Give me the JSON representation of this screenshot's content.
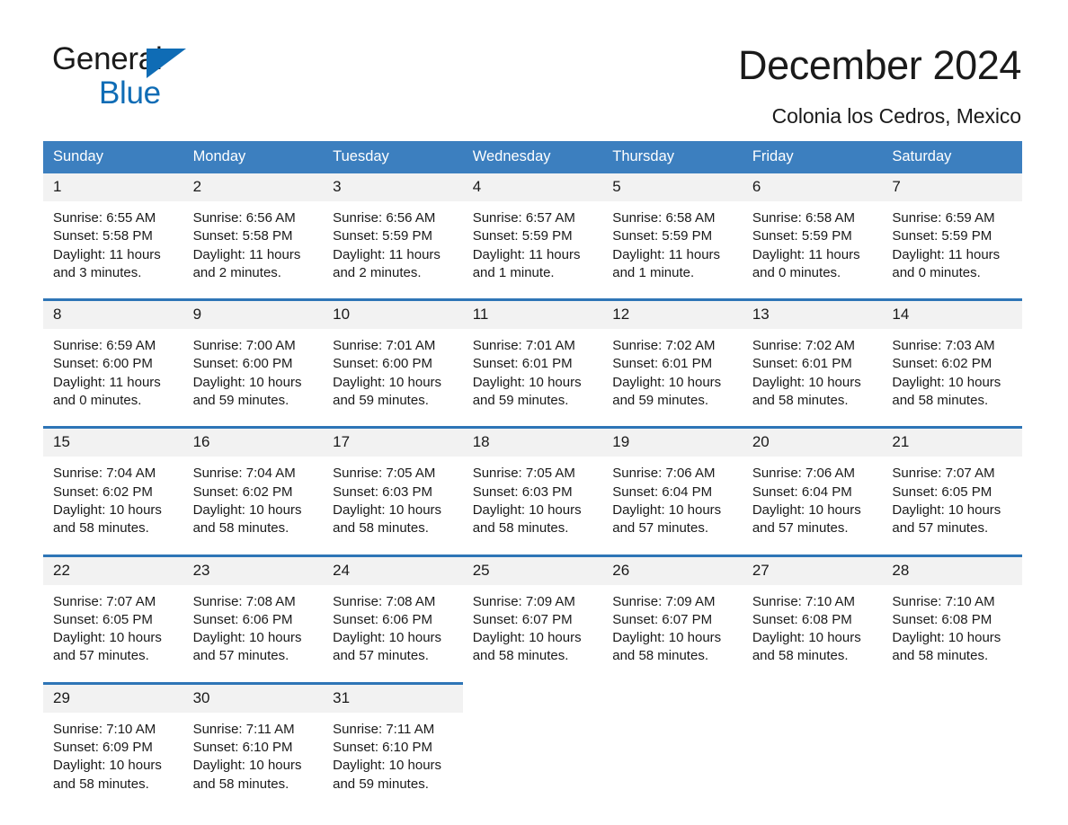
{
  "brand": {
    "name_part1": "General",
    "name_part2": "Blue",
    "triangle_color": "#0f6cb5"
  },
  "header": {
    "month_title": "December 2024",
    "location": "Colonia los Cedros, Mexico"
  },
  "theme": {
    "header_blue": "#3c7fbf",
    "row_divider_blue": "#2e75b6",
    "daynum_band": "#f2f2f2",
    "text": "#1a1a1a"
  },
  "calendar": {
    "weekday_headers": [
      "Sunday",
      "Monday",
      "Tuesday",
      "Wednesday",
      "Thursday",
      "Friday",
      "Saturday"
    ],
    "weeks": [
      {
        "days": [
          {
            "num": "1",
            "sunrise": "Sunrise: 6:55 AM",
            "sunset": "Sunset: 5:58 PM",
            "daylight1": "Daylight: 11 hours",
            "daylight2": "and 3 minutes."
          },
          {
            "num": "2",
            "sunrise": "Sunrise: 6:56 AM",
            "sunset": "Sunset: 5:58 PM",
            "daylight1": "Daylight: 11 hours",
            "daylight2": "and 2 minutes."
          },
          {
            "num": "3",
            "sunrise": "Sunrise: 6:56 AM",
            "sunset": "Sunset: 5:59 PM",
            "daylight1": "Daylight: 11 hours",
            "daylight2": "and 2 minutes."
          },
          {
            "num": "4",
            "sunrise": "Sunrise: 6:57 AM",
            "sunset": "Sunset: 5:59 PM",
            "daylight1": "Daylight: 11 hours",
            "daylight2": "and 1 minute."
          },
          {
            "num": "5",
            "sunrise": "Sunrise: 6:58 AM",
            "sunset": "Sunset: 5:59 PM",
            "daylight1": "Daylight: 11 hours",
            "daylight2": "and 1 minute."
          },
          {
            "num": "6",
            "sunrise": "Sunrise: 6:58 AM",
            "sunset": "Sunset: 5:59 PM",
            "daylight1": "Daylight: 11 hours",
            "daylight2": "and 0 minutes."
          },
          {
            "num": "7",
            "sunrise": "Sunrise: 6:59 AM",
            "sunset": "Sunset: 5:59 PM",
            "daylight1": "Daylight: 11 hours",
            "daylight2": "and 0 minutes."
          }
        ]
      },
      {
        "days": [
          {
            "num": "8",
            "sunrise": "Sunrise: 6:59 AM",
            "sunset": "Sunset: 6:00 PM",
            "daylight1": "Daylight: 11 hours",
            "daylight2": "and 0 minutes."
          },
          {
            "num": "9",
            "sunrise": "Sunrise: 7:00 AM",
            "sunset": "Sunset: 6:00 PM",
            "daylight1": "Daylight: 10 hours",
            "daylight2": "and 59 minutes."
          },
          {
            "num": "10",
            "sunrise": "Sunrise: 7:01 AM",
            "sunset": "Sunset: 6:00 PM",
            "daylight1": "Daylight: 10 hours",
            "daylight2": "and 59 minutes."
          },
          {
            "num": "11",
            "sunrise": "Sunrise: 7:01 AM",
            "sunset": "Sunset: 6:01 PM",
            "daylight1": "Daylight: 10 hours",
            "daylight2": "and 59 minutes."
          },
          {
            "num": "12",
            "sunrise": "Sunrise: 7:02 AM",
            "sunset": "Sunset: 6:01 PM",
            "daylight1": "Daylight: 10 hours",
            "daylight2": "and 59 minutes."
          },
          {
            "num": "13",
            "sunrise": "Sunrise: 7:02 AM",
            "sunset": "Sunset: 6:01 PM",
            "daylight1": "Daylight: 10 hours",
            "daylight2": "and 58 minutes."
          },
          {
            "num": "14",
            "sunrise": "Sunrise: 7:03 AM",
            "sunset": "Sunset: 6:02 PM",
            "daylight1": "Daylight: 10 hours",
            "daylight2": "and 58 minutes."
          }
        ]
      },
      {
        "days": [
          {
            "num": "15",
            "sunrise": "Sunrise: 7:04 AM",
            "sunset": "Sunset: 6:02 PM",
            "daylight1": "Daylight: 10 hours",
            "daylight2": "and 58 minutes."
          },
          {
            "num": "16",
            "sunrise": "Sunrise: 7:04 AM",
            "sunset": "Sunset: 6:02 PM",
            "daylight1": "Daylight: 10 hours",
            "daylight2": "and 58 minutes."
          },
          {
            "num": "17",
            "sunrise": "Sunrise: 7:05 AM",
            "sunset": "Sunset: 6:03 PM",
            "daylight1": "Daylight: 10 hours",
            "daylight2": "and 58 minutes."
          },
          {
            "num": "18",
            "sunrise": "Sunrise: 7:05 AM",
            "sunset": "Sunset: 6:03 PM",
            "daylight1": "Daylight: 10 hours",
            "daylight2": "and 58 minutes."
          },
          {
            "num": "19",
            "sunrise": "Sunrise: 7:06 AM",
            "sunset": "Sunset: 6:04 PM",
            "daylight1": "Daylight: 10 hours",
            "daylight2": "and 57 minutes."
          },
          {
            "num": "20",
            "sunrise": "Sunrise: 7:06 AM",
            "sunset": "Sunset: 6:04 PM",
            "daylight1": "Daylight: 10 hours",
            "daylight2": "and 57 minutes."
          },
          {
            "num": "21",
            "sunrise": "Sunrise: 7:07 AM",
            "sunset": "Sunset: 6:05 PM",
            "daylight1": "Daylight: 10 hours",
            "daylight2": "and 57 minutes."
          }
        ]
      },
      {
        "days": [
          {
            "num": "22",
            "sunrise": "Sunrise: 7:07 AM",
            "sunset": "Sunset: 6:05 PM",
            "daylight1": "Daylight: 10 hours",
            "daylight2": "and 57 minutes."
          },
          {
            "num": "23",
            "sunrise": "Sunrise: 7:08 AM",
            "sunset": "Sunset: 6:06 PM",
            "daylight1": "Daylight: 10 hours",
            "daylight2": "and 57 minutes."
          },
          {
            "num": "24",
            "sunrise": "Sunrise: 7:08 AM",
            "sunset": "Sunset: 6:06 PM",
            "daylight1": "Daylight: 10 hours",
            "daylight2": "and 57 minutes."
          },
          {
            "num": "25",
            "sunrise": "Sunrise: 7:09 AM",
            "sunset": "Sunset: 6:07 PM",
            "daylight1": "Daylight: 10 hours",
            "daylight2": "and 58 minutes."
          },
          {
            "num": "26",
            "sunrise": "Sunrise: 7:09 AM",
            "sunset": "Sunset: 6:07 PM",
            "daylight1": "Daylight: 10 hours",
            "daylight2": "and 58 minutes."
          },
          {
            "num": "27",
            "sunrise": "Sunrise: 7:10 AM",
            "sunset": "Sunset: 6:08 PM",
            "daylight1": "Daylight: 10 hours",
            "daylight2": "and 58 minutes."
          },
          {
            "num": "28",
            "sunrise": "Sunrise: 7:10 AM",
            "sunset": "Sunset: 6:08 PM",
            "daylight1": "Daylight: 10 hours",
            "daylight2": "and 58 minutes."
          }
        ]
      },
      {
        "days": [
          {
            "num": "29",
            "sunrise": "Sunrise: 7:10 AM",
            "sunset": "Sunset: 6:09 PM",
            "daylight1": "Daylight: 10 hours",
            "daylight2": "and 58 minutes."
          },
          {
            "num": "30",
            "sunrise": "Sunrise: 7:11 AM",
            "sunset": "Sunset: 6:10 PM",
            "daylight1": "Daylight: 10 hours",
            "daylight2": "and 58 minutes."
          },
          {
            "num": "31",
            "sunrise": "Sunrise: 7:11 AM",
            "sunset": "Sunset: 6:10 PM",
            "daylight1": "Daylight: 10 hours",
            "daylight2": "and 59 minutes."
          },
          {
            "num": "",
            "sunrise": "",
            "sunset": "",
            "daylight1": "",
            "daylight2": ""
          },
          {
            "num": "",
            "sunrise": "",
            "sunset": "",
            "daylight1": "",
            "daylight2": ""
          },
          {
            "num": "",
            "sunrise": "",
            "sunset": "",
            "daylight1": "",
            "daylight2": ""
          },
          {
            "num": "",
            "sunrise": "",
            "sunset": "",
            "daylight1": "",
            "daylight2": ""
          }
        ]
      }
    ]
  }
}
